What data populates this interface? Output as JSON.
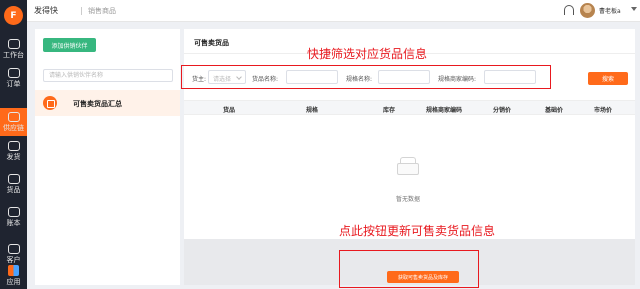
{
  "app": {
    "brand_glyph": "F",
    "title": "发得快",
    "subtitle": "销售商品"
  },
  "nav": {
    "items": [
      {
        "label": "工作台",
        "icon": "dashboard-icon"
      },
      {
        "label": "订单",
        "icon": "order-icon"
      },
      {
        "label": "供应链",
        "icon": "supply-chain-icon",
        "active": true
      },
      {
        "label": "发货",
        "icon": "truck-icon"
      },
      {
        "label": "货品",
        "icon": "goods-icon"
      },
      {
        "label": "账本",
        "icon": "ledger-icon"
      },
      {
        "label": "客户",
        "icon": "customer-icon"
      },
      {
        "label": "应用",
        "icon": "apps-icon"
      }
    ]
  },
  "user": {
    "name": "曹老板a"
  },
  "sidebar": {
    "add_partner_label": "添加供销伙伴",
    "search_placeholder": "请输入供销伙伴名称",
    "items": [
      {
        "label": "可售卖货品汇总"
      }
    ]
  },
  "main": {
    "title": "可售卖货品",
    "filters": {
      "supplier_label": "货主:",
      "supplier_placeholder": "请选择",
      "goods_name_label": "货品名称:",
      "spec_name_label": "规格名称:",
      "spec_code_label": "规格商家编码:",
      "search_label": "搜索"
    },
    "table": {
      "columns": [
        "货品",
        "规格",
        "库存",
        "规格商家编码",
        "分销价",
        "基础价",
        "市场价"
      ]
    },
    "empty_text": "暂无数据",
    "update_button_label": "获取可售卖货品及库存"
  },
  "annotations": {
    "filter_note": "快捷筛选对应货品信息",
    "update_note": "点此按钮更新可售卖货品信息",
    "color": "#e8191f"
  },
  "colors": {
    "accent": "#ff6a1a",
    "green": "#37b77f",
    "nav_bg": "#1f2430"
  }
}
